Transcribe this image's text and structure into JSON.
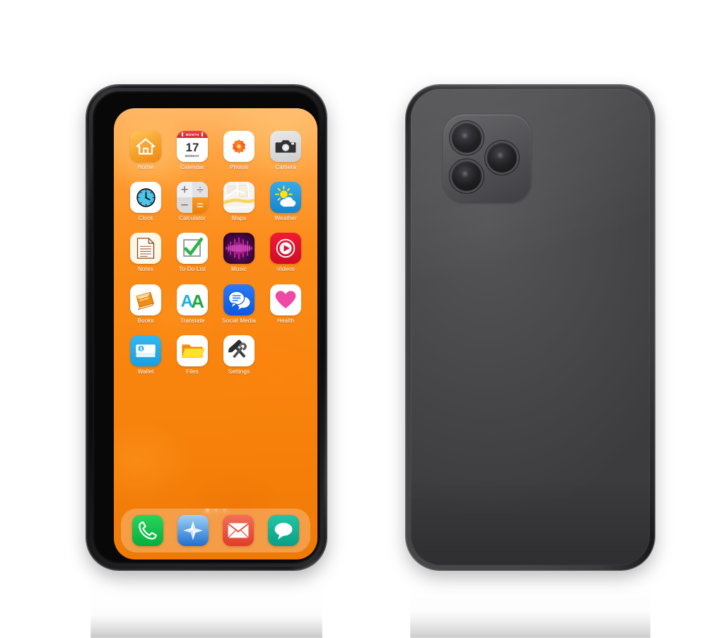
{
  "scene": {
    "description": "Two smartphones shown side by side on a white background with reflections",
    "background_color": "#ffffff"
  },
  "front_phone": {
    "name": "front-facing smartphone",
    "frame_color": "#141416",
    "screen": {
      "wallpaper_color": "#f9850f",
      "app_grid": [
        {
          "label": "Home",
          "icon": "home-icon",
          "tile_color": "#f5a623"
        },
        {
          "label": "Calendar",
          "icon": "calendar-icon",
          "tile_color": "#ffffff",
          "month": "MONTH",
          "day_number": "17",
          "weekday": "MONDAY"
        },
        {
          "label": "Photos",
          "icon": "photos-flower-icon",
          "tile_color": "#ffffff"
        },
        {
          "label": "Camera",
          "icon": "camera-icon",
          "tile_color": "#d5d5d7"
        },
        {
          "label": "Clock",
          "icon": "clock-icon",
          "tile_color": "#ffffff"
        },
        {
          "label": "Calculator",
          "icon": "calculator-icon",
          "tile_color": "#e8e8e8"
        },
        {
          "label": "Maps",
          "icon": "map-icon",
          "tile_color": "#f2f0ec"
        },
        {
          "label": "Weather",
          "icon": "sun-cloud-icon",
          "tile_color": "#1e9ae0"
        },
        {
          "label": "Notes",
          "icon": "notes-page-icon",
          "tile_color": "#fdf6e3"
        },
        {
          "label": "To-Do List",
          "icon": "checkmark-box-icon",
          "tile_color": "#ffffff"
        },
        {
          "label": "Music",
          "icon": "waveform-icon",
          "tile_color": "#2a0030"
        },
        {
          "label": "Videos",
          "icon": "play-circle-icon",
          "tile_color": "#e8112d"
        },
        {
          "label": "Books",
          "icon": "book-icon",
          "tile_color": "#ffffff"
        },
        {
          "label": "Translate",
          "icon": "letters-aa-icon",
          "tile_color": "#ffffff"
        },
        {
          "label": "Social Media",
          "icon": "chat-bubbles-icon",
          "tile_color": "#1266f1"
        },
        {
          "label": "Health",
          "icon": "heart-icon",
          "tile_color": "#ffffff"
        },
        {
          "label": "Wallet",
          "icon": "money-stack-icon",
          "tile_color": "#2badea"
        },
        {
          "label": "Files",
          "icon": "folder-icon",
          "tile_color": "#ffffff"
        },
        {
          "label": "Settings",
          "icon": "hammer-wrench-icon",
          "tile_color": "#ffffff"
        }
      ],
      "page_dots": {
        "count": 3,
        "active_index": 0
      },
      "dock": [
        {
          "label": "Phone",
          "icon": "phone-handset-icon",
          "tile_color": "#16c24a"
        },
        {
          "label": "Browser",
          "icon": "compass-icon",
          "tile_color": "#2f8ae0"
        },
        {
          "label": "Mail",
          "icon": "envelope-icon",
          "tile_color": "#e8503a"
        },
        {
          "label": "Messages",
          "icon": "speech-bubble-icon",
          "tile_color": "#12b193"
        }
      ]
    }
  },
  "back_phone": {
    "name": "rear-facing smartphone",
    "body_color": "#46464a",
    "camera_module": {
      "name": "triple-camera-module",
      "lens_count": 3,
      "lenses": [
        "lens-top-left",
        "lens-bottom-left",
        "lens-middle-right"
      ]
    }
  }
}
